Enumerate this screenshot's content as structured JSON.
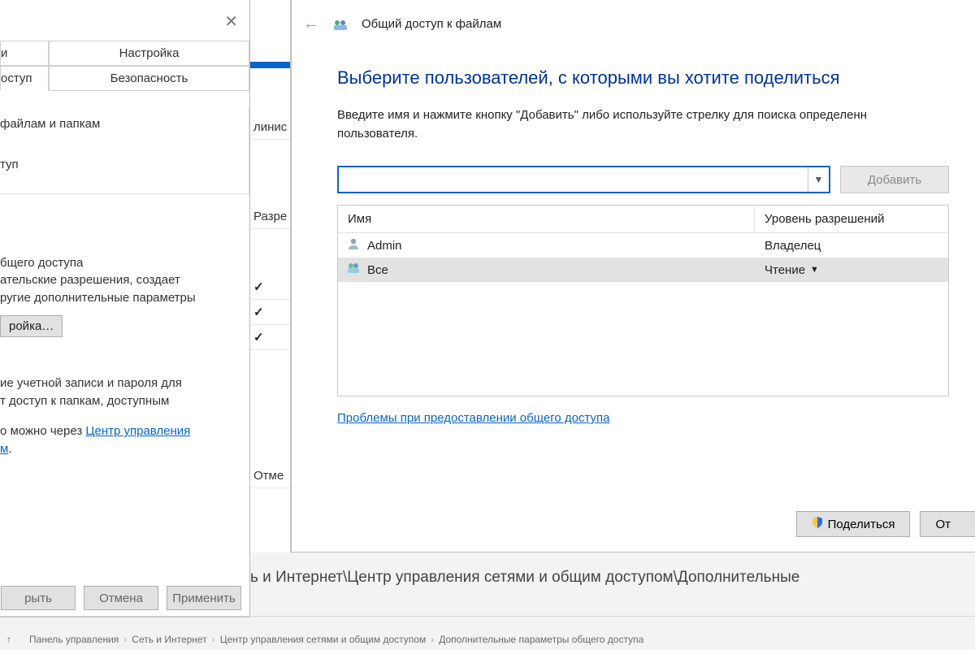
{
  "wizard": {
    "title": "Общий доступ к файлам",
    "heading": "Выберите пользователей, с которыми вы хотите поделиться",
    "hint": "Введите имя и нажмите кнопку \"Добавить\" либо используйте стрелку для поиска определенн пользователя.",
    "add": "Добавить",
    "col_name": "Имя",
    "col_perm": "Уровень разрешений",
    "users": [
      {
        "name": "Admin",
        "perm": "Владелец",
        "selected": false,
        "dropdown": false
      },
      {
        "name": "Все",
        "perm": "Чтение",
        "selected": true,
        "dropdown": true
      }
    ],
    "help_link": "Проблемы при предоставлении общего доступа",
    "share_btn": "Поделиться",
    "cancel_btn": "От"
  },
  "props": {
    "tab_i": "и",
    "tab_settings": "Настройка",
    "tab_access": "оступ",
    "tab_security": "Безопасность",
    "line_files": "файлам и папкам",
    "line_tup": "туп",
    "sect_title": "бщего доступа",
    "sect_l1": "ательские разрешения, создает",
    "sect_l2": "ругие дополнительные параметры",
    "adv_btn": "ройка…",
    "pw_l1": "ие учетной записи и пароля для",
    "pw_l2": "т доступ к папкам, доступным",
    "pw_l3_a": "о можно через ",
    "pw_link": "Центр управления",
    "pw_l4": "м",
    "btn_close": "рыть",
    "btn_cancel": "Отмена",
    "btn_apply": "Применить"
  },
  "mid": {
    "r1": "линис",
    "r2": "Разре",
    "r3": "Отме"
  },
  "bottom": {
    "path": "ь и Интернет\\Центр управления сетями и общим доступом\\Дополнительные",
    "faint": "",
    "crumbs": [
      "Панель управления",
      "Сеть и Интернет",
      "Центр управления сетями и общим доступом",
      "Дополнительные параметры общего доступа"
    ]
  }
}
